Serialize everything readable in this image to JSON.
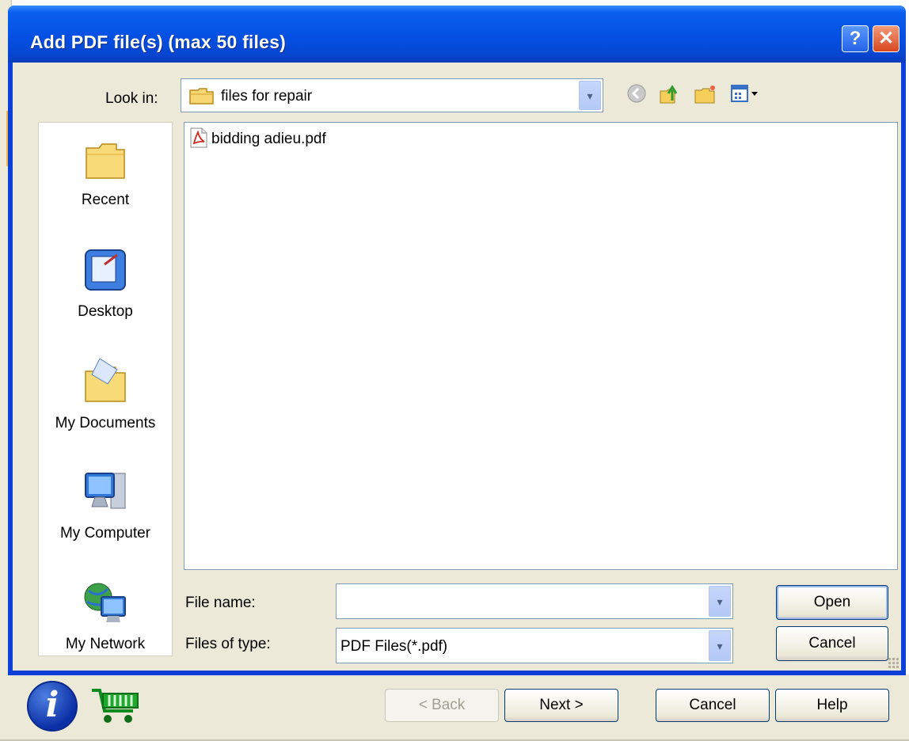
{
  "dialog": {
    "title": "Add PDF file(s) (max 50 files)",
    "help_glyph": "?",
    "close_glyph": "✕"
  },
  "lookin": {
    "label": "Look in:",
    "value": "files for repair",
    "arrow": "▾"
  },
  "places": [
    {
      "label": "Recent",
      "icon": "recent-folder-icon"
    },
    {
      "label": "Desktop",
      "icon": "desktop-icon"
    },
    {
      "label": "My Documents",
      "icon": "my-documents-icon"
    },
    {
      "label": "My Computer",
      "icon": "my-computer-icon"
    },
    {
      "label": "My Network",
      "icon": "my-network-icon"
    }
  ],
  "files": [
    {
      "name": "bidding adieu.pdf",
      "icon": "pdf-file-icon"
    }
  ],
  "form": {
    "filename_label": "File name:",
    "filename_value": "",
    "filetype_label": "Files of type:",
    "filetype_value": "PDF Files(*.pdf)",
    "open_label": "Open",
    "cancel_label": "Cancel",
    "arrow": "▾"
  },
  "wizard": {
    "back_label": "< Back",
    "next_label": "Next >",
    "cancel_label": "Cancel",
    "help_label": "Help",
    "info_glyph": "i"
  },
  "colors": {
    "titlebar": "#0550e3",
    "dialog_bg": "#ece9d8",
    "close_button": "#d9471f"
  }
}
